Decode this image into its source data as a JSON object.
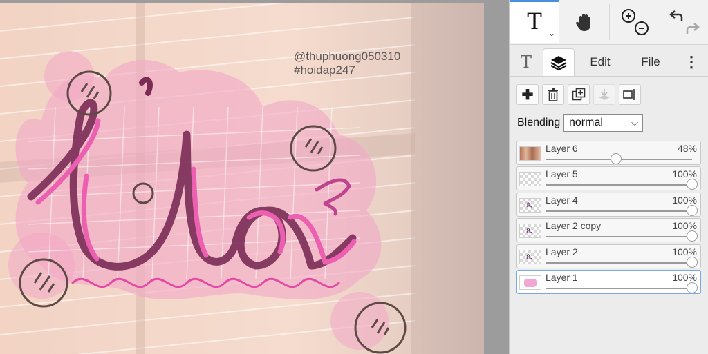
{
  "canvas": {
    "watermark": [
      "@thuphuong050310",
      "#hoidap247"
    ],
    "artwork_text": "Ưa"
  },
  "toolbar": {
    "tools": [
      {
        "name": "text-tool",
        "icon": "text-icon",
        "glyph": "T",
        "active": true
      },
      {
        "name": "hand-tool",
        "icon": "hand-icon",
        "active": false
      },
      {
        "name": "zoom-tool",
        "icon": "zoom-icon",
        "active": false
      },
      {
        "name": "undo-redo",
        "icon": "undo-redo-icon",
        "active": false
      }
    ]
  },
  "tabs": [
    {
      "label": "T",
      "icon": "text-icon"
    },
    {
      "label": "",
      "icon": "layers-icon",
      "active": true
    },
    {
      "label": "Edit"
    },
    {
      "label": "File"
    },
    {
      "label": "",
      "icon": "more-vertical-icon"
    }
  ],
  "layer_actions": [
    "add-layer",
    "delete-layer",
    "duplicate-layer",
    "merge-down",
    "layer-properties"
  ],
  "blending": {
    "label": "Blending",
    "value": "normal"
  },
  "layers": [
    {
      "name": "Layer 6",
      "opacity": "48%",
      "opacity_value": 0.48,
      "thumb": "photo",
      "selected": false
    },
    {
      "name": "Layer 5",
      "opacity": "100%",
      "opacity_value": 1.0,
      "thumb": "empty",
      "selected": false
    },
    {
      "name": "Layer 4",
      "opacity": "100%",
      "opacity_value": 1.0,
      "thumb": "mark",
      "selected": false
    },
    {
      "name": "Layer 2 copy",
      "opacity": "100%",
      "opacity_value": 1.0,
      "thumb": "mark",
      "selected": false
    },
    {
      "name": "Layer 2",
      "opacity": "100%",
      "opacity_value": 1.0,
      "thumb": "mark",
      "selected": false
    },
    {
      "name": "Layer 1",
      "opacity": "100%",
      "opacity_value": 1.0,
      "thumb": "pink",
      "selected": true
    }
  ],
  "colors": {
    "accent": "#4a90e2",
    "pink": "#e85db0",
    "dark_stroke": "#7a2c55",
    "paper": "#f3d8c8"
  }
}
